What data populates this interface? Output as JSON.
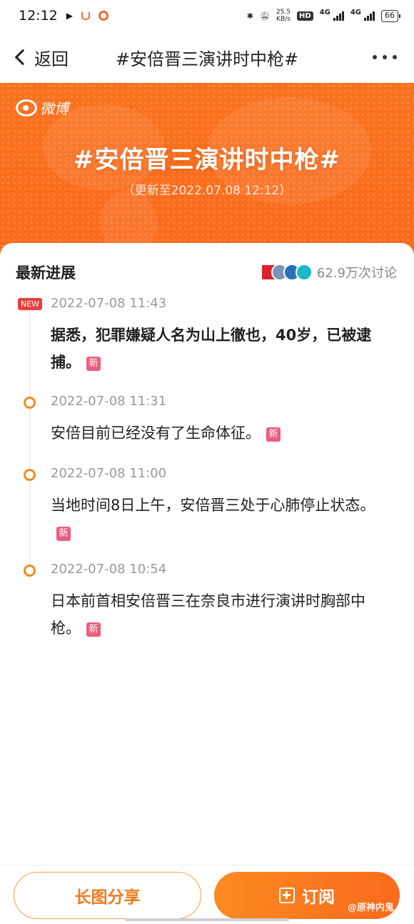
{
  "status_bar": {
    "time": "12:12",
    "net_speed_value": "25.5",
    "net_speed_unit": "KB/s",
    "hd_badge": "HD",
    "network_1": "4G",
    "network_2": "4G",
    "battery": "66"
  },
  "nav": {
    "back_label": "返回",
    "title": "#安倍晋三演讲时中枪#"
  },
  "banner": {
    "logo_text": "微博",
    "title": "#安倍晋三演讲时中枪#",
    "subtitle": "（更新至2022.07.08 12:12）"
  },
  "section": {
    "title": "最新进展",
    "discussion_count": "62.9万次讨论"
  },
  "timeline": [
    {
      "time": "2022-07-08 11:43",
      "text": "据悉，犯罪嫌疑人名为山上徹也，40岁，已被逮捕。",
      "badge": "NEW",
      "tag": "新"
    },
    {
      "time": "2022-07-08 11:31",
      "text": "安倍目前已经没有了生命体征。",
      "tag": "新"
    },
    {
      "time": "2022-07-08 11:00",
      "text": "当地时间8日上午，安倍晋三处于心肺停止状态。",
      "tag": "新"
    },
    {
      "time": "2022-07-08 10:54",
      "text": "日本前首相安倍晋三在奈良市进行演讲时胸部中枪。",
      "tag": "新"
    }
  ],
  "bottom_bar": {
    "share_label": "长图分享",
    "subscribe_label": "订阅",
    "watermark": "@原神内鬼"
  },
  "colors": {
    "brand_orange": "#fb6a1e",
    "tag_pink": "#ee5d7e",
    "new_red": "#e8403a"
  }
}
